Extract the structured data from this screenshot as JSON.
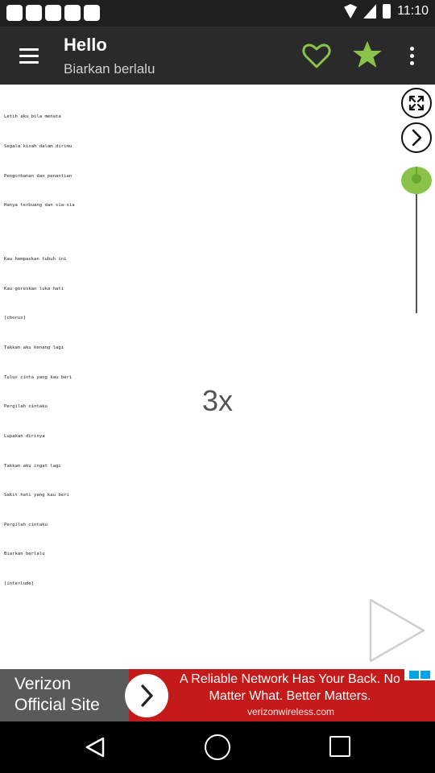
{
  "status_bar": {
    "time": "11:10",
    "icons": [
      "notification-icon",
      "notification-icon",
      "notification-icon",
      "notification-icon",
      "notification-icon",
      "wifi-icon",
      "signal-icon",
      "battery-icon"
    ]
  },
  "app_bar": {
    "title": "Hello",
    "subtitle": "Biarkan berlalu",
    "menu_icon": "hamburger-menu-icon",
    "favorite_icon": "heart-outline-icon",
    "star_icon": "star-filled-icon",
    "more_icon": "more-vert-icon",
    "accent_color": "#8bc34a"
  },
  "lyrics": {
    "lines": [
      "Letih aku bila menata",
      "Segala kisah dalam dirimu",
      "Pengorbanan dan penantian",
      "Hanya terbuang dan sia-sia",
      "",
      "Kau hempaskan tubuh ini",
      "Kau goreskan luka hati",
      "[chorus]",
      "Takkan aku kenang lagi",
      "Tulus cinta yang kau beri",
      "Pergilah cintaku",
      "Lupakan dirinya",
      "Takkan aku ingat lagi",
      "Sakit hati yang kau beri",
      "Pergilah cintaku",
      "Biarkan berlalu",
      "[interlude]"
    ]
  },
  "controls": {
    "fullscreen_icon": "fullscreen-icon",
    "next_icon": "chevron-right-icon",
    "scroll_speed_label": "3x",
    "play_icon": "play-icon"
  },
  "ad": {
    "brand_line1": "Verizon",
    "brand_line2": "Official Site",
    "headline_line1": "A Reliable Network Has Your Back. No",
    "headline_line2": "Matter What. Better Matters.",
    "domain": "verizonwireless.com",
    "background_color": "#c41a1a"
  },
  "nav_bar": {
    "back_icon": "back-triangle-icon",
    "home_icon": "home-circle-icon",
    "recent_icon": "recent-apps-square-icon"
  }
}
